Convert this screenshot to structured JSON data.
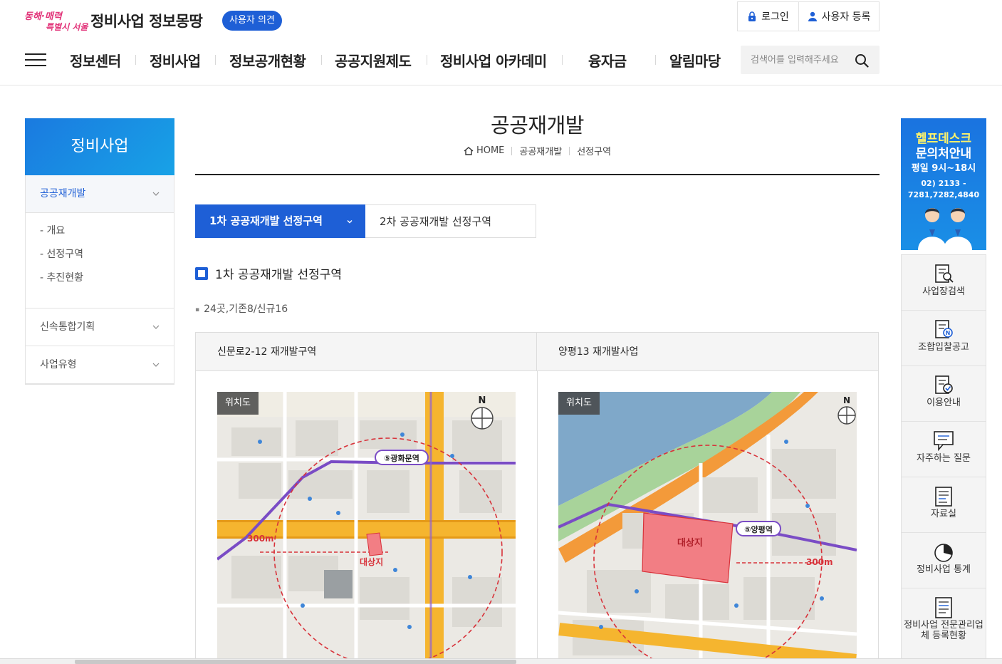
{
  "header": {
    "logo_line1": "동해·매력",
    "logo_line2": "특별시 서울",
    "site_title": "정비사업 정보몽땅",
    "opinion_badge": "사용자 의견",
    "login": "로그인",
    "register": "사용자 등록",
    "search_placeholder": "검색어를 입력해주세요"
  },
  "gnb": [
    "정보센터",
    "정비사업",
    "정보공개현황",
    "공공지원제도",
    "정비사업 아카데미",
    "융자금",
    "알림마당"
  ],
  "sidebar": {
    "title": "정비사업",
    "categories": [
      {
        "label": "공공재개발",
        "sub": [
          "- 개요",
          "- 선정구역",
          "- 추진현황"
        ]
      },
      {
        "label": "신속통합기획"
      },
      {
        "label": "사업유형"
      }
    ]
  },
  "main": {
    "page_title": "공공재개발",
    "breadcrumb": [
      "HOME",
      "공공재개발",
      "선정구역"
    ],
    "tabs": [
      "1차 공공재개발 선정구역",
      "2차 공공재개발 선정구역"
    ],
    "section_title": "1차 공공재개발 선정구역",
    "count": "24곳,기존8/신규16",
    "cards": [
      {
        "title": "신문로2-12 재개발구역",
        "map_label": "위치도",
        "station": "⑤광화문역",
        "radius": "300m",
        "target": "대상지",
        "north": "N"
      },
      {
        "title": "양평13 재개발사업",
        "map_label": "위치도",
        "station": "⑤양평역",
        "radius": "300m",
        "target": "대상지",
        "north": "N"
      }
    ]
  },
  "helpdesk": {
    "line1": "헬프데스크",
    "line2": "문의처안내",
    "hours": "평일 9시~18시",
    "phone": "02) 2133 - 7281,7282,4840"
  },
  "quick_menu": [
    "사업장검색",
    "조합입찰공고",
    "이용안내",
    "자주하는 질문",
    "자료실",
    "정비사업 통계",
    "정비사업 전문관리업체 등록현황"
  ],
  "colors": {
    "primary": "#1e5fd6",
    "accent_pink": "#e2357a",
    "helpdesk_yellow": "#fff36a"
  }
}
